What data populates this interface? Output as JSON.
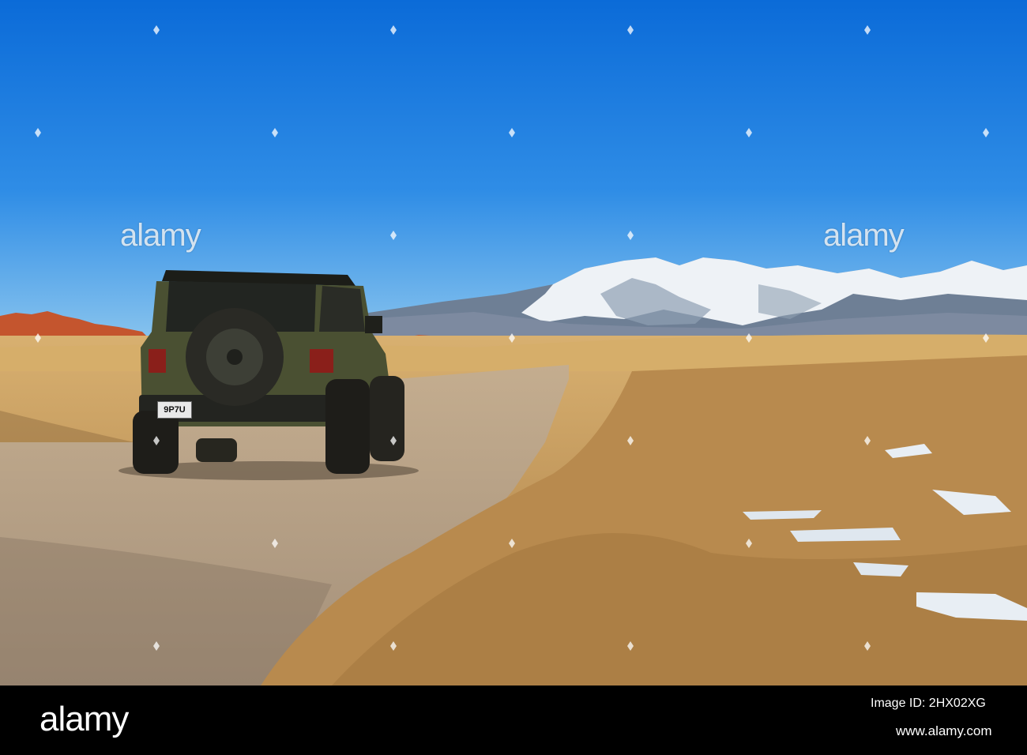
{
  "photo": {
    "scene": "sky-mountains-desert-road",
    "colors": {
      "sky_top": "#0a6fdc",
      "sky_bottom": "#7fc0ee",
      "snow": "#f2f5f8",
      "mountain_shadow": "#5f6f86",
      "grass": "#c99a55",
      "road": "#b7a48e",
      "jeep_body": "#4a5032"
    },
    "plate_text": "9P7U",
    "watermarks": [
      "alamy",
      "alamy"
    ]
  },
  "footer": {
    "logo": "alamy",
    "image_id": "Image ID: 2HX02XG",
    "url": "www.alamy.com"
  }
}
